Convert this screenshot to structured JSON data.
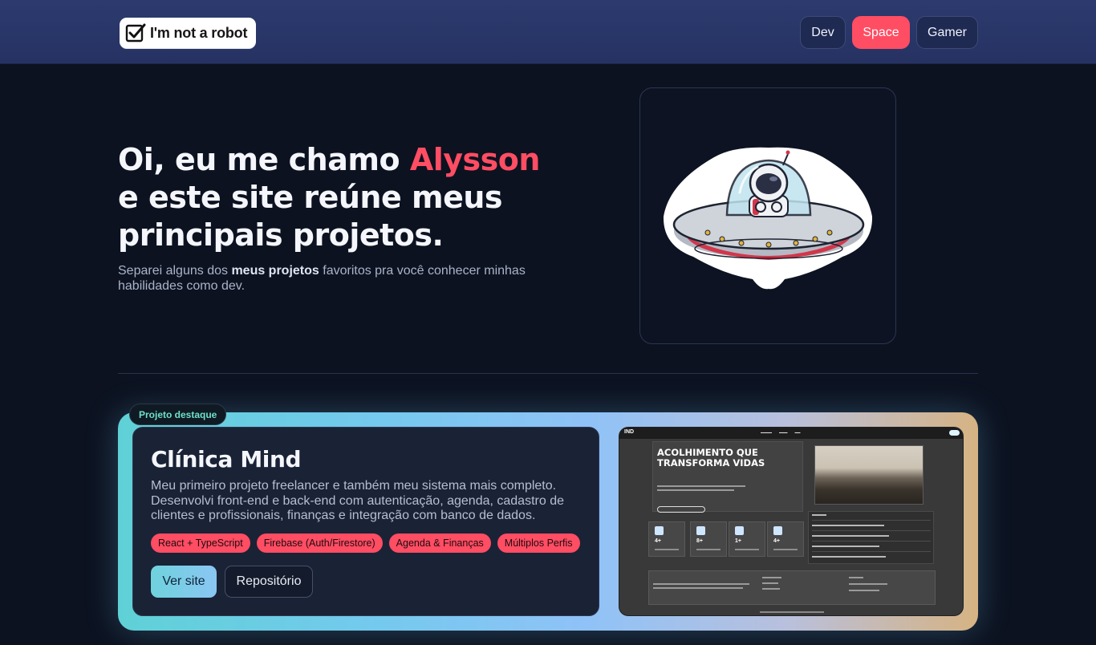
{
  "header": {
    "logo_text": "I'm not a robot",
    "themes": [
      {
        "label": "Dev",
        "active": false
      },
      {
        "label": "Space",
        "active": true
      },
      {
        "label": "Gamer",
        "active": false
      }
    ]
  },
  "hero": {
    "greeting_prefix": "Oi, eu me chamo ",
    "name": "Alysson",
    "greeting_suffix": "e este site reúne meus principais projetos.",
    "subtitle_prefix": "Separei alguns dos ",
    "subtitle_bold": "meus projetos",
    "subtitle_suffix": " favoritos pra você conhecer minhas habilidades como dev.",
    "illustration": "astronaut-ufo-icon"
  },
  "featured": {
    "badge": "Projeto destaque",
    "title": "Clínica Mind",
    "description": "Meu primeiro projeto freelancer e também meu sistema mais completo. Desenvolvi front-end e back-end com autenticação, agenda, cadastro de clientes e profissionais, finanças e integração com banco de dados.",
    "tags": [
      "React + TypeScript",
      "Firebase (Auth/Firestore)",
      "Agenda & Finanças",
      "Múltiplos Perfis"
    ],
    "view_site_label": "Ver site",
    "repo_label": "Repositório",
    "preview": {
      "logo": "IND",
      "headline": "ACOLHIMENTO QUE TRANSFORMA VIDAS",
      "stats": [
        "4+",
        "8+",
        "1+",
        "4+"
      ]
    }
  },
  "colors": {
    "accent": "#ff4d63",
    "background": "#0c1220",
    "header": "#2c3a6e",
    "badge_text": "#6fe0c8"
  }
}
